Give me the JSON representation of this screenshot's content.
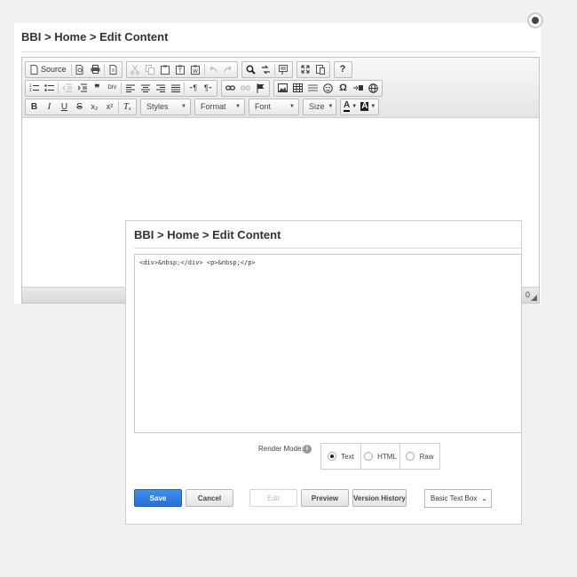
{
  "background_editor": {
    "title": "BBI > Home > Edit Content",
    "toolbar": {
      "source_label": "Source",
      "styles_combo": "Styles",
      "format_combo": "Format",
      "font_combo": "Font",
      "size_combo": "Size",
      "font_color_glyph": "A",
      "bg_color_glyph": "A",
      "bold_glyph": "B",
      "italic_glyph": "I",
      "underline_glyph": "U",
      "strike_glyph": "S",
      "sub_glyph": "x₂",
      "sup_glyph": "x²",
      "clear_glyph": "Tₓ",
      "help_glyph": "?",
      "omega_glyph": "Ω",
      "quote_glyph": "❞",
      "spell_glyph": "ABC"
    },
    "word_count": "0"
  },
  "dialog": {
    "title": "BBI > Home > Edit Content",
    "code_content": "<div>&nbsp;</div> <p>&nbsp;</p>",
    "render_mode_label": "Render Mode:",
    "info_glyph": "i",
    "render_options": [
      {
        "label": "Text",
        "selected": true
      },
      {
        "label": "HTML",
        "selected": false
      },
      {
        "label": "Raw",
        "selected": false
      }
    ],
    "buttons": {
      "save": "Save",
      "cancel": "Cancel",
      "edit": "Edit",
      "preview": "Preview",
      "version_history": "Version History"
    },
    "box_type_select": "Basic Text Box"
  },
  "colors": {
    "primary_button": "#2f7fe6",
    "page_background": "#f1f1f1"
  }
}
